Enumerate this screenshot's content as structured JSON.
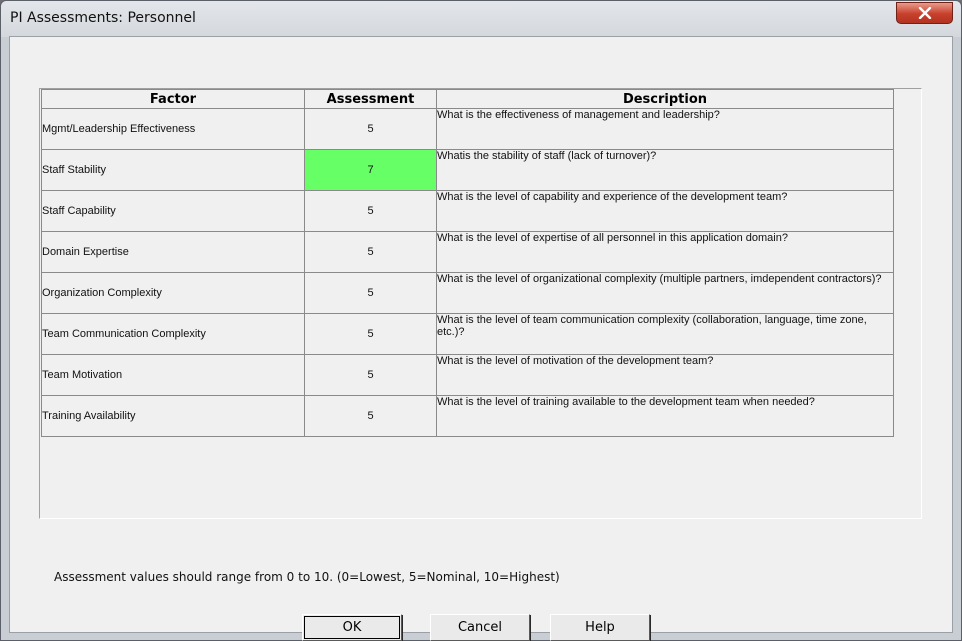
{
  "window": {
    "title": "PI Assessments: Personnel"
  },
  "table": {
    "headers": {
      "factor": "Factor",
      "assessment": "Assessment",
      "description": "Description"
    },
    "rows": [
      {
        "factor": "Mgmt/Leadership Effectiveness",
        "assessment": "5",
        "description": "What is the effectiveness of management and leadership?",
        "highlighted": false
      },
      {
        "factor": "Staff Stability",
        "assessment": "7",
        "description": "Whatis the stability of staff (lack of turnover)?",
        "highlighted": true
      },
      {
        "factor": "Staff Capability",
        "assessment": "5",
        "description": "What is the level of capability and experience of the development team?",
        "highlighted": false
      },
      {
        "factor": "Domain Expertise",
        "assessment": "5",
        "description": "What is the level of expertise of all personnel in this application domain?",
        "highlighted": false
      },
      {
        "factor": "Organization Complexity",
        "assessment": "5",
        "description": "What is the level of organizational complexity (multiple partners, imdependent contractors)?",
        "highlighted": false
      },
      {
        "factor": "Team Communication Complexity",
        "assessment": "5",
        "description": "What is the level of team communication complexity (collaboration, language, time zone, etc.)?",
        "highlighted": false
      },
      {
        "factor": "Team Motivation",
        "assessment": "5",
        "description": "What is the level of motivation of the development team?",
        "highlighted": false
      },
      {
        "factor": "Training Availability",
        "assessment": "5",
        "description": "What is the level of training available to the development team when needed?",
        "highlighted": false
      }
    ],
    "highlight_color": "#66ff66"
  },
  "note": "Assessment values should range from 0 to 10.   (0=Lowest, 5=Nominal, 10=Highest)",
  "buttons": {
    "ok": "OK",
    "cancel": "Cancel",
    "help": "Help"
  },
  "icons": {
    "close": "close-icon"
  }
}
